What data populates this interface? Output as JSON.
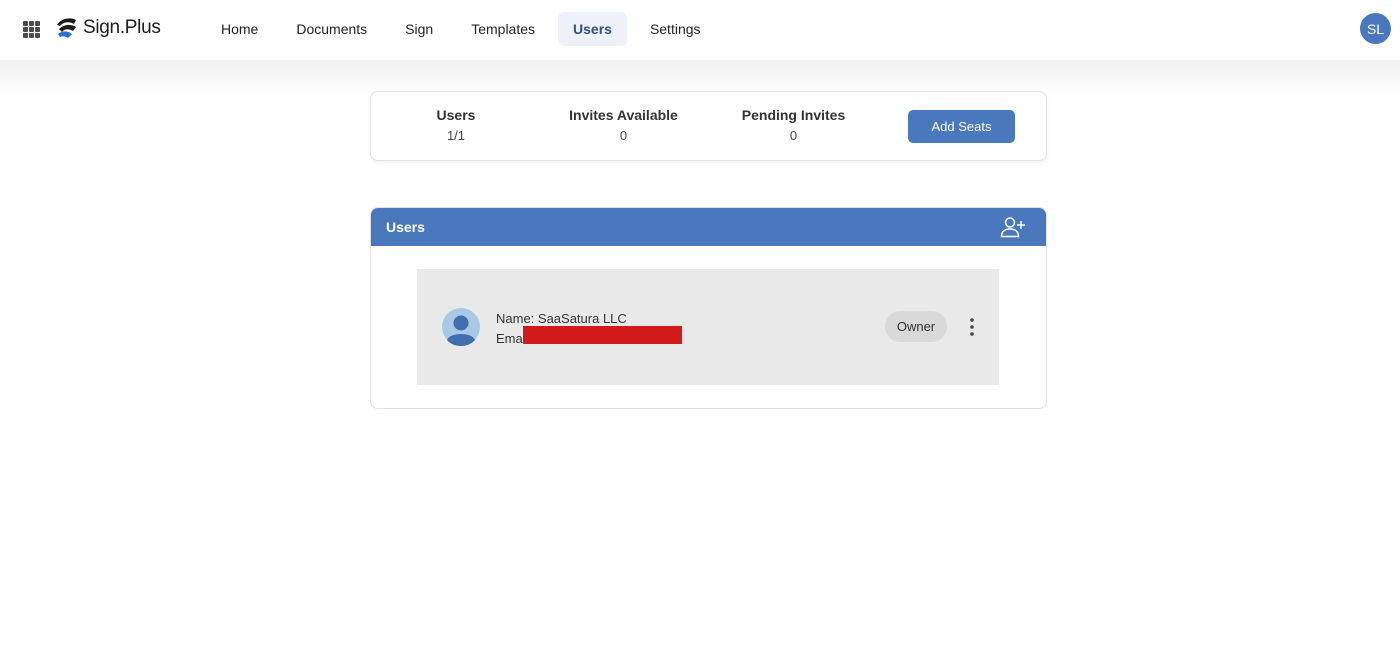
{
  "app": {
    "logo_text": "Sign.Plus"
  },
  "nav": {
    "items": [
      {
        "label": "Home"
      },
      {
        "label": "Documents"
      },
      {
        "label": "Sign"
      },
      {
        "label": "Templates"
      },
      {
        "label": "Users",
        "active": true
      },
      {
        "label": "Settings"
      }
    ]
  },
  "account": {
    "initials": "SL"
  },
  "stats": {
    "users_label": "Users",
    "users_value": "1/1",
    "invites_label": "Invites Available",
    "invites_value": "0",
    "pending_label": "Pending Invites",
    "pending_value": "0",
    "add_seats_label": "Add Seats"
  },
  "users_panel": {
    "title": "Users",
    "rows": [
      {
        "name_line": "Name: SaaSatura LLC",
        "email_prefix": "Ema",
        "role": "Owner"
      }
    ]
  },
  "colors": {
    "accent": "#4a78bd",
    "redaction": "#d21a1a",
    "row_background": "#e9e9e9"
  },
  "icons": [
    "apps-grid-icon",
    "sign-plus-logo",
    "add-user-icon",
    "user-avatar-icon",
    "more-vertical-icon"
  ]
}
